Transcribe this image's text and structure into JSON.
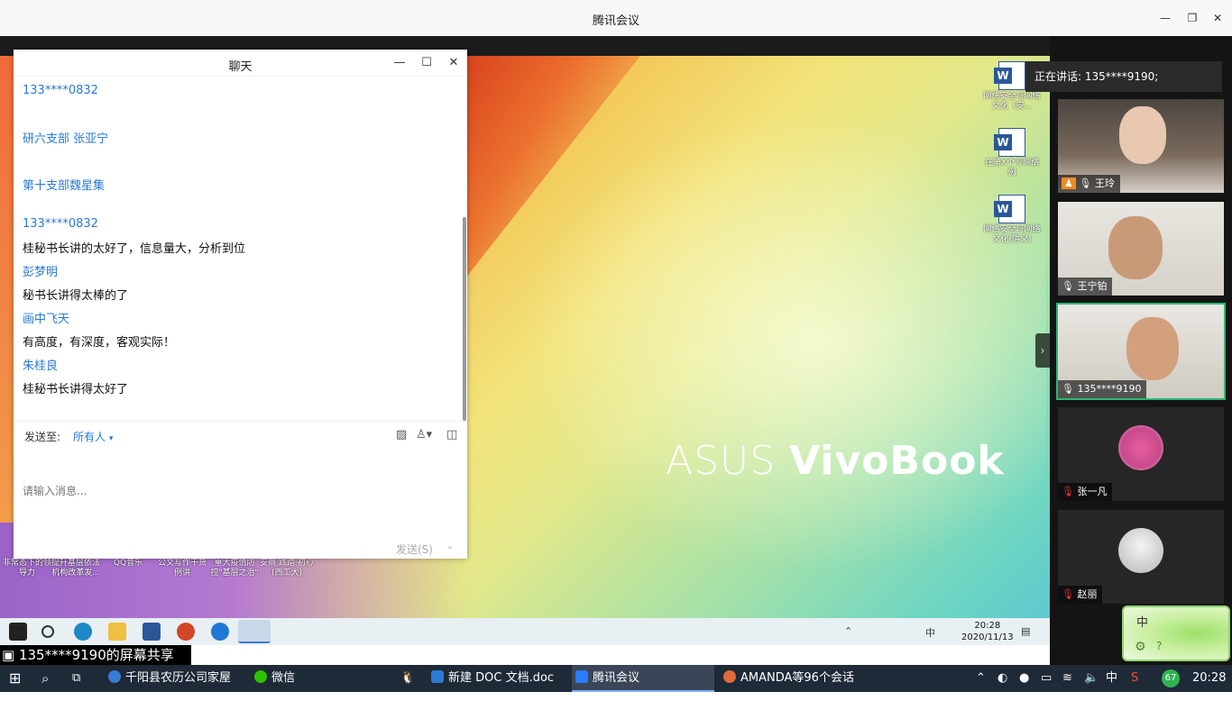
{
  "window": {
    "title": "腾讯会议"
  },
  "chat": {
    "title": "聊天",
    "messages": [
      {
        "name": "133****0832",
        "text": ""
      },
      {
        "name": "研六支部 张亚宁",
        "text": ""
      },
      {
        "name": "第十支部魏星集",
        "text": ""
      },
      {
        "name": "133****0832",
        "text": "桂秘书长讲的太好了，信息量大，分析到位"
      },
      {
        "name": "彭梦明",
        "text": "秘书长讲得太棒的了"
      },
      {
        "name": "画中飞天",
        "text": "有高度，有深度，客观实际！"
      },
      {
        "name": "朱桂良",
        "text": "桂秘书长讲得太好了"
      }
    ],
    "send_to_label": "发送至:",
    "recipient": "所有人",
    "input_placeholder": "请输入消息...",
    "send_button": "发送(S)"
  },
  "shared_screen": {
    "brand": {
      "part1": "ASUS ",
      "part2": "VivoBook"
    },
    "desktop_icons": [
      {
        "label": "网络安全与网络文化（安..."
      },
      {
        "label": "在第X个专网络例"
      },
      {
        "label": "网络安全与网络文化(讲义)"
      }
    ],
    "bottom_icons": [
      {
        "label": "非常态下的领导力"
      },
      {
        "label": "提升基层依法机构改革发..."
      },
      {
        "label": "QQ音乐"
      },
      {
        "label": "公文写作干货例讲"
      },
      {
        "label": "重大疫情防控\"基层之治\""
      },
      {
        "label": "安商 践踏 初心 (西工大)"
      }
    ],
    "remote_clock": {
      "time": "20:28",
      "date": "2020/11/13"
    },
    "remote_ime": "中"
  },
  "share_bar": {
    "text": "135****9190的屏幕共享"
  },
  "panel": {
    "speaking": "正在讲话: 135****9190;",
    "participants": [
      {
        "name": "王玲",
        "muted": false,
        "video": true
      },
      {
        "name": "王宁铂",
        "muted": false,
        "video": true
      },
      {
        "name": "135****9190",
        "muted": false,
        "video": true,
        "active": true
      },
      {
        "name": "张一凡",
        "muted": true,
        "video": false
      },
      {
        "name": "赵丽",
        "muted": true,
        "video": false
      }
    ],
    "ime_label": "中"
  },
  "taskbar": {
    "apps": [
      {
        "label": "千阳县农历公司家屋_..."
      },
      {
        "label": "微信"
      },
      {
        "label": "新建 DOC 文档.doc ..."
      },
      {
        "label": "腾讯会议"
      },
      {
        "label": "AMANDA等96个会话"
      }
    ],
    "ime": "中",
    "badge": "67",
    "time": "20:28"
  },
  "colors": {
    "accent": "#2a79d6",
    "active_speaker": "#2bb673",
    "taskbar": "#1f2a38"
  }
}
